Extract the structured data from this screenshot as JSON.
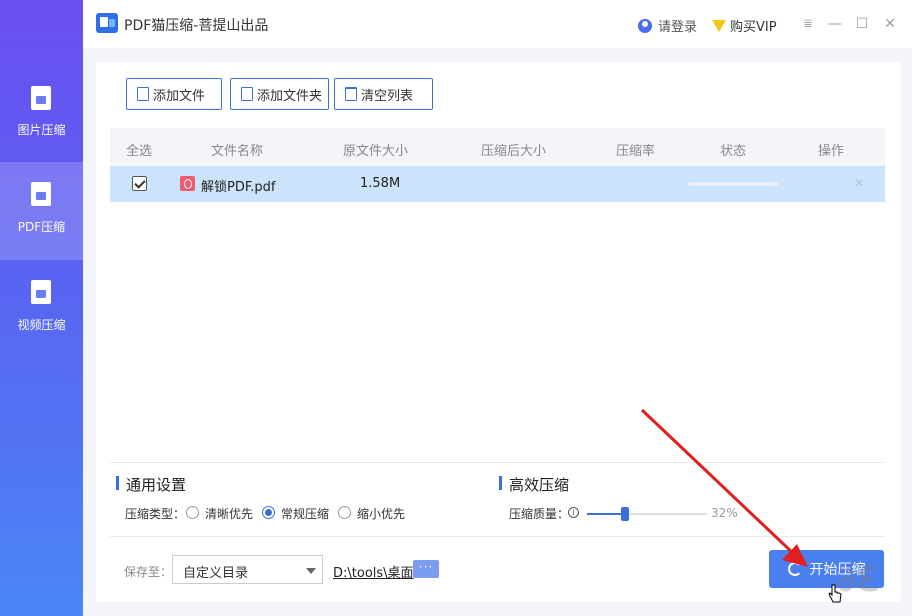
{
  "app": {
    "title": "PDF猫压缩-菩提山出品",
    "login": "请登录",
    "vip": "购买VIP"
  },
  "window_buttons": [
    "menu-icon",
    "minimize-icon",
    "maximize-icon",
    "close-icon"
  ],
  "sidebar": {
    "items": [
      {
        "label": "图片压缩",
        "icon": "image-file-icon",
        "active": false
      },
      {
        "label": "PDF压缩",
        "icon": "pdf-file-icon",
        "active": true
      },
      {
        "label": "视频压缩",
        "icon": "video-file-icon",
        "active": false
      }
    ]
  },
  "toolbar": {
    "add_file": "添加文件",
    "add_folder": "添加文件夹",
    "clear_list": "清空列表"
  },
  "table": {
    "headers": [
      "全选",
      "文件名称",
      "原文件大小",
      "压缩后大小",
      "压缩率",
      "状态",
      "操作"
    ],
    "rows": [
      {
        "checked": true,
        "name": "解锁PDF.pdf",
        "original_size": "1.58M",
        "compressed_size": "",
        "ratio": "",
        "progress": 0
      }
    ]
  },
  "general_settings": {
    "title": "通用设置",
    "type_label": "压缩类型：",
    "options": [
      "清晰优先",
      "常规压缩",
      "缩小优先"
    ],
    "selected": "常规压缩"
  },
  "efficient": {
    "title": "高效压缩",
    "quality_label": "压缩质量：",
    "quality_value": 0.32,
    "quality_text": "32%"
  },
  "save": {
    "label": "保存至：",
    "select_value": "自定义目录",
    "path": "D:\\tools\\桌面",
    "more": "···"
  },
  "start_button": "开始压缩",
  "colors": {
    "accent": "#3a6fd8",
    "sidebar_top": "#6a4ff0",
    "sidebar_bottom": "#4a86f5",
    "selected_row": "#cce4fb",
    "annotation_arrow": "#e02020"
  }
}
